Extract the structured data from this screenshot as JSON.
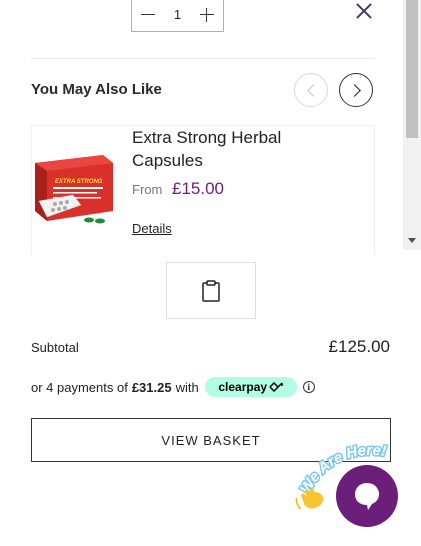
{
  "cart_item": {
    "quantity": "1",
    "decrease_icon": "minus-icon",
    "increase_icon": "plus-icon"
  },
  "close_icon": "close-icon",
  "recommendations": {
    "title": "You May Also Like",
    "prev_icon": "chevron-left-icon",
    "next_icon": "chevron-right-icon",
    "product": {
      "name": "Extra Strong Herbal Capsules",
      "from_label": "From",
      "price": "£15.00",
      "details_label": "Details",
      "image_label": "EXTRA STRONG"
    }
  },
  "clipboard_icon": "clipboard-icon",
  "summary": {
    "subtotal_label": "Subtotal",
    "subtotal_value": "£125.00",
    "installment_prefix": "or 4 payments of",
    "installment_amount": "£31.25",
    "installment_with": "with",
    "provider": "clearpay",
    "info_icon": "info-icon"
  },
  "view_basket_label": "VIEW BASKET",
  "chat": {
    "banner": "We Are Here!",
    "wave_icon": "waving-hand-icon",
    "chat_icon": "chat-bubble-icon"
  },
  "colors": {
    "price": "#6b1e7a",
    "chat_button": "#6b1e7a",
    "clearpay_badge": "#b2fce4"
  }
}
